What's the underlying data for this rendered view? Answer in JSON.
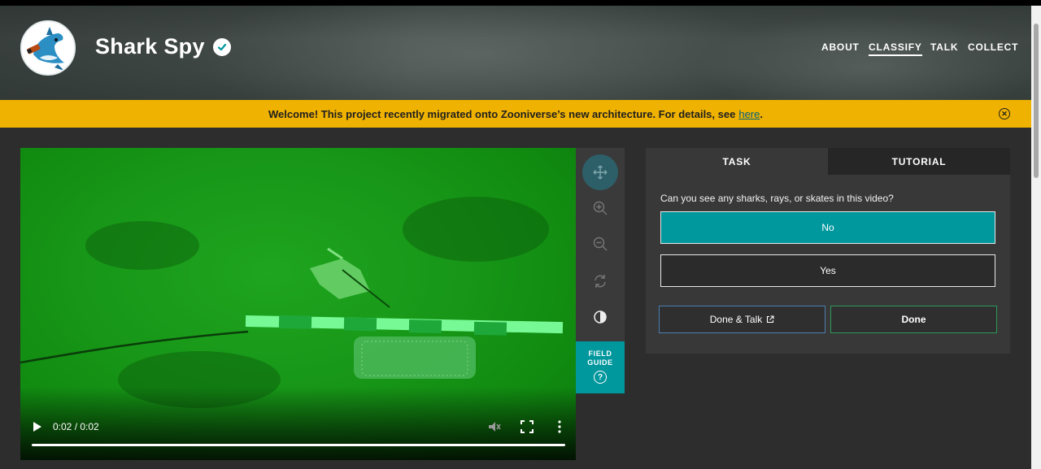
{
  "project": {
    "title": "Shark Spy",
    "verified_icon": "check-circle-icon"
  },
  "nav": {
    "items": [
      {
        "label": "ABOUT"
      },
      {
        "label": "CLASSIFY",
        "active": true
      },
      {
        "label": "TALK"
      },
      {
        "label": "COLLECT"
      }
    ]
  },
  "banner": {
    "text": "Welcome! This project recently migrated onto Zooniverse’s new architecture. For details, see",
    "link": "here",
    "suffix": ".",
    "color": "#f0b200"
  },
  "video": {
    "time": "0:02 / 0:02",
    "progress": 1.0
  },
  "toolbar": {
    "tools": [
      "move-icon",
      "zoom-in-icon",
      "zoom-out-icon",
      "rotate-icon",
      "invert-icon"
    ],
    "field_guide_label_1": "FIELD",
    "field_guide_label_2": "GUIDE",
    "field_guide_icon": "?"
  },
  "task": {
    "tabs": [
      {
        "label": "TASK",
        "active": true
      },
      {
        "label": "TUTORIAL",
        "active": false
      }
    ],
    "question": "Can you see any sharks, rays, or skates in this video?",
    "answers": [
      {
        "label": "No",
        "selected": true
      },
      {
        "label": "Yes",
        "selected": false
      }
    ],
    "done_talk": "Done & Talk",
    "done": "Done",
    "accent": "#00979d"
  }
}
